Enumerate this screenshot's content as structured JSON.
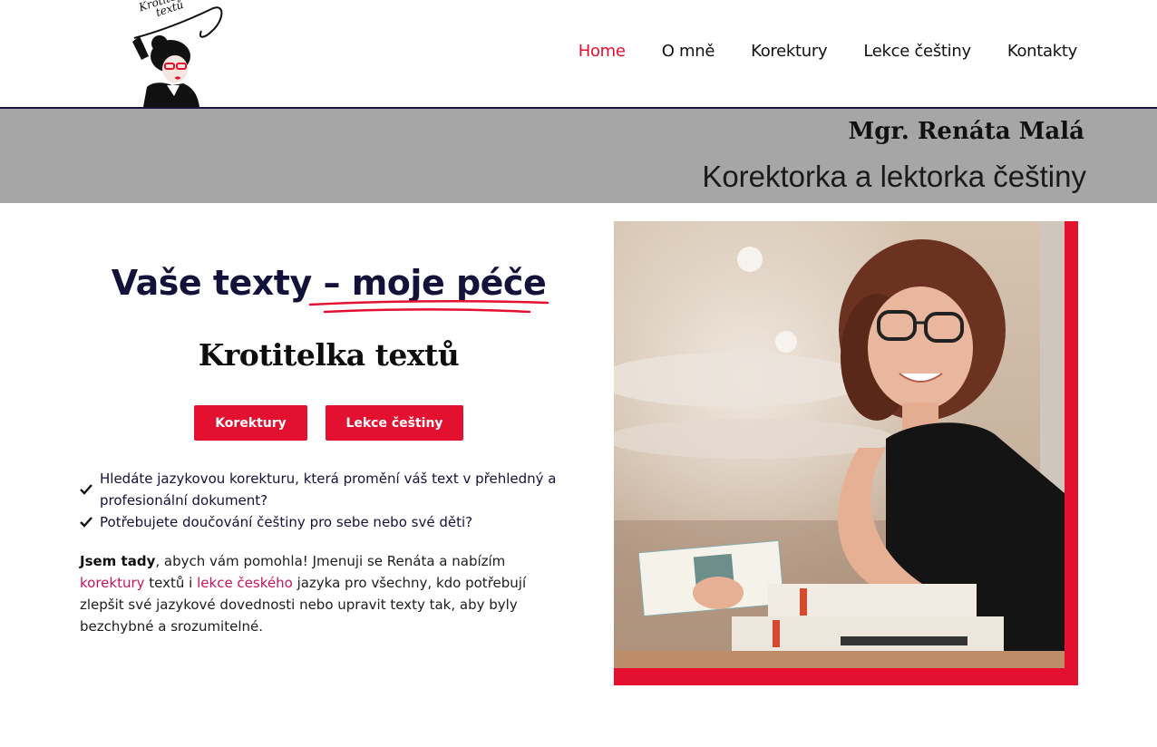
{
  "logo": {
    "text_line1": "Krotitelka",
    "text_line2": "textů"
  },
  "nav": {
    "items": [
      {
        "label": "Home",
        "active": true
      },
      {
        "label": "O mně",
        "active": false
      },
      {
        "label": "Korektury",
        "active": false
      },
      {
        "label": "Lekce češtiny",
        "active": false
      },
      {
        "label": "Kontakty",
        "active": false
      }
    ]
  },
  "banner": {
    "name": "Mgr. Renáta Malá",
    "role": "Korektorka a lektorka češtiny"
  },
  "hero": {
    "headline_part1": "Vaše texty ",
    "headline_part2": "– moje péče",
    "brand_title": "Krotitelka textů",
    "buttons": {
      "primary": "Korektury",
      "secondary": "Lekce češtiny"
    },
    "checklist": [
      "Hledáte jazykovou korekturu, která promění váš text v přehledný a profesionální dokument?",
      "Potřebujete doučování češtiny pro sebe nebo své děti?"
    ],
    "intro": {
      "bold": "Jsem tady",
      "text1": ", abych vám pomohla! Jmenuji se Renáta a nabízím ",
      "link1": "korektury",
      "text2": " textů i ",
      "link2": "lekce českého",
      "text3": " jazyka pro všechny, kdo potřebují zlepšit své jazykové dovednosti nebo upravit texty tak, aby byly bezchybné a srozumitelné."
    }
  },
  "colors": {
    "accent": "#e3102f",
    "navy": "#14123a",
    "banner_gray": "#a6a6a6",
    "link": "#c2185b"
  },
  "icons": {
    "check": "check-icon",
    "logo": "logo-illustration"
  }
}
